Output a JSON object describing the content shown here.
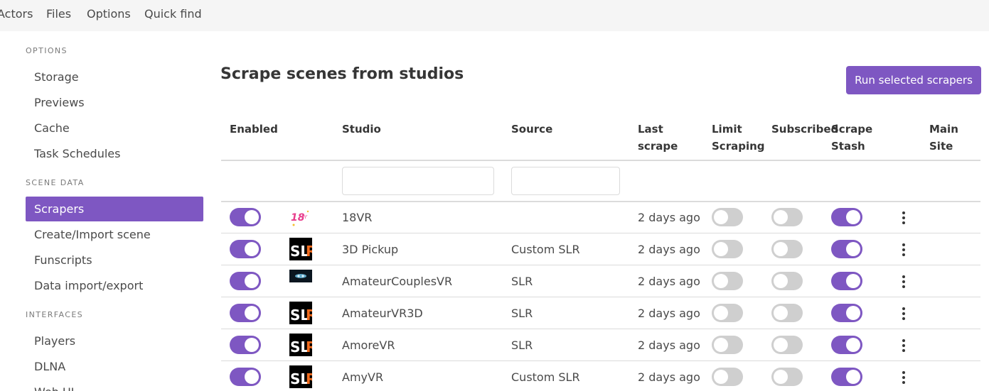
{
  "nav": {
    "items": [
      "Actors",
      "Files",
      "Options",
      "Quick find"
    ]
  },
  "sidebar": {
    "sections": [
      {
        "label": "OPTIONS",
        "items": [
          "Storage",
          "Previews",
          "Cache",
          "Task Schedules"
        ]
      },
      {
        "label": "SCENE DATA",
        "items": [
          "Scrapers",
          "Create/Import scene",
          "Funscripts",
          "Data import/export"
        ]
      },
      {
        "label": "INTERFACES",
        "items": [
          "Players",
          "DLNA",
          "Web UI"
        ]
      }
    ],
    "active_item": "Scrapers"
  },
  "main": {
    "title": "Scrape scenes from studios",
    "run_button_label": "Run selected scrapers"
  },
  "table": {
    "headers": {
      "enabled": "Enabled",
      "studio": "Studio",
      "source": "Source",
      "last_scrape_1": "Last",
      "last_scrape_2": "scrape",
      "limit_1": "Limit",
      "limit_2": "Scraping",
      "subscribed": "Subscribed",
      "stash_1": "Scrape",
      "stash_2": "Stash",
      "main_1": "Main",
      "main_2": "Site"
    },
    "filters": {
      "studio_value": "",
      "source_value": ""
    },
    "rows": [
      {
        "logo": "18vr-logo",
        "studio": "18VR",
        "source": "",
        "last_scrape": "2 days ago",
        "enabled": true,
        "limit_scraping": false,
        "subscribed": false,
        "scrape_stash": true
      },
      {
        "logo": "slr-logo",
        "studio": "3D Pickup",
        "source": "Custom SLR",
        "last_scrape": "2 days ago",
        "enabled": true,
        "limit_scraping": false,
        "subscribed": false,
        "scrape_stash": true
      },
      {
        "logo": "amateurcouplesvr-logo",
        "studio": "AmateurCouplesVR",
        "source": "SLR",
        "last_scrape": "2 days ago",
        "enabled": true,
        "limit_scraping": false,
        "subscribed": false,
        "scrape_stash": true
      },
      {
        "logo": "slr-logo",
        "studio": "AmateurVR3D",
        "source": "SLR",
        "last_scrape": "2 days ago",
        "enabled": true,
        "limit_scraping": false,
        "subscribed": false,
        "scrape_stash": true
      },
      {
        "logo": "slr-logo",
        "studio": "AmoreVR",
        "source": "SLR",
        "last_scrape": "2 days ago",
        "enabled": true,
        "limit_scraping": false,
        "subscribed": false,
        "scrape_stash": true
      },
      {
        "logo": "slr-logo",
        "studio": "AmyVR",
        "source": "Custom SLR",
        "last_scrape": "2 days ago",
        "enabled": true,
        "limit_scraping": false,
        "subscribed": false,
        "scrape_stash": true
      }
    ]
  },
  "colors": {
    "accent": "#7e57c2",
    "toggle_off": "#cfcfcf",
    "nav_bg": "#f5f5f5",
    "slr_orange": "#f26b1d"
  }
}
